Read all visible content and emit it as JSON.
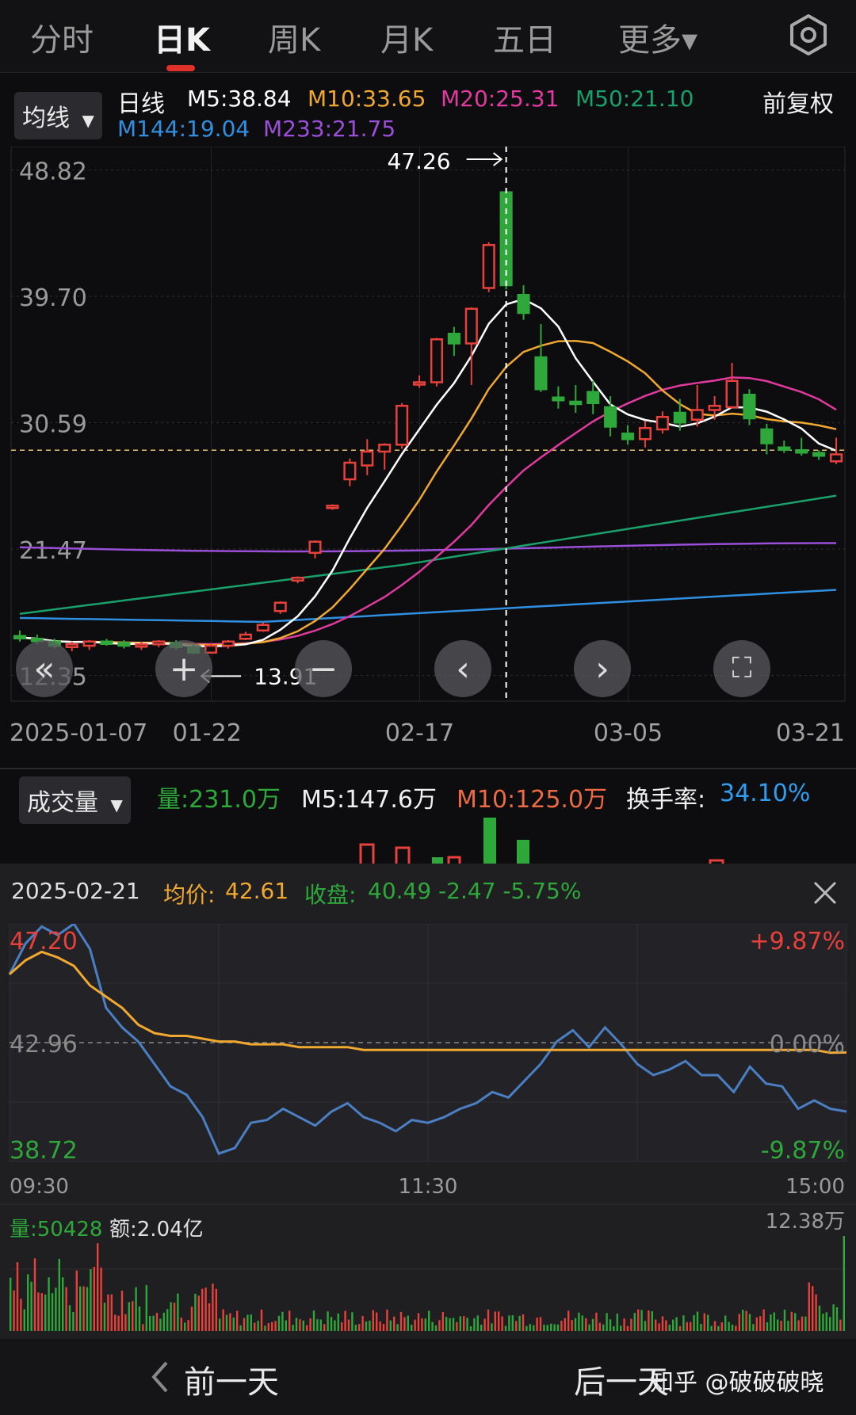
{
  "tabs": [
    {
      "label": "分时",
      "active": false
    },
    {
      "label": "日K",
      "active": true
    },
    {
      "label": "周K",
      "active": false
    },
    {
      "label": "月K",
      "active": false
    },
    {
      "label": "五日",
      "active": false
    },
    {
      "label": "更多▾",
      "active": false
    }
  ],
  "settings_icon": "gear-icon",
  "kline_legend": {
    "dropdown": "均线",
    "period": "日线",
    "adjust": "前复权",
    "ma": [
      {
        "label": "M5:38.84",
        "color": "#ffffff"
      },
      {
        "label": "M10:33.65",
        "color": "#f0a830"
      },
      {
        "label": "M20:25.31",
        "color": "#e03a9e"
      },
      {
        "label": "M50:21.10",
        "color": "#1aa06a"
      },
      {
        "label": "M144:19.04",
        "color": "#2f8fe0"
      },
      {
        "label": "M233:21.75",
        "color": "#9b4fd8"
      }
    ]
  },
  "kline_axis": {
    "price_labels": [
      "48.82",
      "39.70",
      "30.59",
      "21.47",
      "12.35"
    ],
    "date_labels": [
      "2025-01-07",
      "01-22",
      "02-17",
      "03-05",
      "03-21"
    ],
    "high_marker": "47.26",
    "low_marker": "13.91"
  },
  "controls": [
    {
      "name": "fast-back-icon",
      "glyph": "«"
    },
    {
      "name": "zoom-in-icon",
      "glyph": "+"
    },
    {
      "name": "zoom-out-icon",
      "glyph": "−"
    },
    {
      "name": "prev-icon",
      "glyph": "‹"
    },
    {
      "name": "next-icon",
      "glyph": "›"
    },
    {
      "name": "fullscreen-icon",
      "glyph": "⛶"
    }
  ],
  "volume_legend": {
    "dropdown": "成交量",
    "vol_label": "量:231.0万",
    "m5_label": "M5:147.6万",
    "m10_label": "M10:125.0万",
    "turnover_label": "换手率:",
    "turnover_value": "34.10%"
  },
  "intraday": {
    "date": "2025-02-21",
    "avg_label": "均价:",
    "avg_value": "42.61",
    "close_label": "收盘:",
    "close_value": "40.49 -2.47 -5.75%",
    "high_price": "47.20",
    "mid_price": "42.96",
    "low_price": "38.72",
    "high_pct": "+9.87%",
    "mid_pct": "0.00%",
    "low_pct": "-9.87%",
    "times": [
      "09:30",
      "11:30",
      "15:00"
    ],
    "vol_label": "量:50428",
    "amount_label": "额:2.04亿",
    "vol_max": "12.38万"
  },
  "bottom_nav": {
    "prev_label": "前一天",
    "next_label": "后一天",
    "watermark": "知乎 @破破破晓"
  },
  "colors": {
    "up": "#e8403a",
    "down": "#2ea83a",
    "price_line": "#4a7fc4",
    "avg_line": "#f0a830",
    "turnover": "#2f9df0"
  },
  "chart_data": [
    {
      "type": "candlestick",
      "title": "",
      "x": [
        "01-07",
        "01-08",
        "01-09",
        "01-10",
        "01-13",
        "01-14",
        "01-15",
        "01-16",
        "01-17",
        "01-20",
        "01-21",
        "01-22",
        "01-23",
        "01-24",
        "01-27",
        "02-05",
        "02-06",
        "02-07",
        "02-10",
        "02-11",
        "02-12",
        "02-13",
        "02-14",
        "02-17",
        "02-18",
        "02-19",
        "02-20",
        "02-21",
        "02-24",
        "02-25",
        "02-26",
        "02-27",
        "02-28",
        "03-03",
        "03-04",
        "03-05",
        "03-06",
        "03-07",
        "03-10",
        "03-11",
        "03-12",
        "03-13",
        "03-14",
        "03-17",
        "03-18",
        "03-19",
        "03-20",
        "03-21"
      ],
      "ohlc": [
        [
          15.2,
          15.6,
          14.8,
          15.1
        ],
        [
          15.0,
          15.3,
          14.6,
          14.9
        ],
        [
          14.8,
          15.0,
          14.3,
          14.5
        ],
        [
          14.4,
          14.8,
          14.1,
          14.6
        ],
        [
          14.5,
          14.9,
          14.2,
          14.8
        ],
        [
          14.8,
          15.0,
          14.5,
          14.7
        ],
        [
          14.7,
          14.9,
          14.3,
          14.5
        ],
        [
          14.5,
          14.8,
          14.2,
          14.6
        ],
        [
          14.6,
          14.9,
          14.4,
          14.8
        ],
        [
          14.7,
          14.9,
          14.2,
          14.4
        ],
        [
          14.4,
          14.6,
          13.91,
          14.0
        ],
        [
          14.0,
          14.7,
          13.95,
          14.5
        ],
        [
          14.5,
          14.9,
          14.3,
          14.8
        ],
        [
          15.0,
          15.5,
          14.9,
          15.3
        ],
        [
          15.6,
          16.2,
          15.5,
          16.0
        ],
        [
          17.0,
          17.7,
          16.8,
          17.6
        ],
        [
          19.2,
          19.5,
          19.0,
          19.4
        ],
        [
          21.2,
          22.1,
          20.8,
          22.0
        ],
        [
          24.5,
          24.7,
          24.3,
          24.6
        ],
        [
          26.5,
          28.0,
          26.0,
          27.7
        ],
        [
          27.5,
          29.4,
          26.8,
          28.5
        ],
        [
          28.5,
          29.1,
          27.2,
          29.0
        ],
        [
          29.0,
          32.0,
          28.7,
          31.8
        ],
        [
          33.4,
          34.0,
          33.1,
          33.5
        ],
        [
          33.5,
          36.7,
          33.2,
          36.6
        ],
        [
          37.0,
          37.5,
          35.4,
          36.3
        ],
        [
          36.3,
          38.9,
          33.3,
          38.8
        ],
        [
          40.3,
          43.6,
          40.0,
          43.4
        ],
        [
          47.2,
          47.26,
          40.2,
          40.5
        ],
        [
          39.8,
          40.5,
          38.0,
          38.5
        ],
        [
          35.3,
          37.7,
          32.8,
          33.0
        ],
        [
          32.4,
          33.2,
          31.6,
          32.2
        ],
        [
          32.1,
          33.3,
          31.3,
          32.0
        ],
        [
          32.8,
          33.6,
          31.2,
          32.0
        ],
        [
          31.7,
          32.5,
          29.6,
          30.3
        ],
        [
          29.8,
          30.4,
          29.0,
          29.4
        ],
        [
          29.4,
          30.7,
          28.8,
          30.2
        ],
        [
          30.1,
          31.4,
          29.8,
          31.0
        ],
        [
          31.3,
          32.3,
          30.0,
          30.6
        ],
        [
          30.8,
          33.3,
          30.3,
          31.5
        ],
        [
          31.5,
          32.5,
          30.8,
          31.8
        ],
        [
          31.7,
          34.9,
          31.6,
          33.6
        ],
        [
          32.6,
          33.0,
          30.4,
          30.9
        ],
        [
          30.1,
          30.5,
          28.3,
          29.1
        ],
        [
          28.8,
          29.3,
          28.4,
          28.7
        ],
        [
          28.6,
          29.5,
          28.2,
          28.5
        ],
        [
          28.4,
          28.6,
          27.9,
          28.2
        ],
        [
          27.8,
          29.5,
          27.6,
          28.3
        ]
      ],
      "ylim": [
        10.5,
        50.5
      ],
      "y_ticks": [
        48.82,
        39.7,
        30.59,
        21.47,
        12.35
      ],
      "high": 47.26,
      "low": 13.91,
      "current_price_line": 28.6
    },
    {
      "type": "line",
      "title": "",
      "x": [
        "09:30",
        "11:30",
        "15:00"
      ],
      "series": [
        {
          "name": "",
          "values": [
            45.4,
            46.5,
            47.1,
            46.8,
            47.2,
            46.3,
            44.2,
            43.5,
            43.0,
            42.2,
            41.4,
            41.1,
            40.3,
            39.0,
            39.2,
            40.1,
            40.2,
            40.6,
            40.3,
            40.0,
            40.5,
            40.8,
            40.3,
            40.1,
            39.8,
            40.2,
            40.1,
            40.3,
            40.6,
            40.8,
            41.2,
            41.0,
            41.6,
            42.2,
            43.0,
            43.4,
            42.8,
            43.5,
            42.9,
            42.2,
            41.8,
            42.0,
            42.3,
            41.8,
            41.8,
            41.2,
            42.1,
            41.5,
            41.4,
            40.6,
            40.9,
            40.6,
            40.5
          ],
          "color": "#4a7fc4"
        },
        {
          "name": "",
          "values": [
            45.4,
            45.9,
            46.2,
            46.0,
            45.7,
            45.0,
            44.6,
            44.2,
            43.6,
            43.3,
            43.2,
            43.2,
            43.1,
            43.0,
            43.0,
            42.9,
            42.9,
            42.9,
            42.8,
            42.8,
            42.8,
            42.8,
            42.7,
            42.7,
            42.7,
            42.7,
            42.7,
            42.7,
            42.7,
            42.7,
            42.7,
            42.7,
            42.7,
            42.7,
            42.7,
            42.7,
            42.7,
            42.7,
            42.7,
            42.7,
            42.7,
            42.7,
            42.7,
            42.7,
            42.7,
            42.7,
            42.7,
            42.7,
            42.7,
            42.7,
            42.7,
            42.6,
            42.61
          ],
          "color": "#f0a830"
        }
      ],
      "ylim": [
        38.72,
        47.2
      ],
      "reference": 42.96,
      "y_pct": [
        "+9.87%",
        "0.00%",
        "-9.87%"
      ]
    }
  ]
}
